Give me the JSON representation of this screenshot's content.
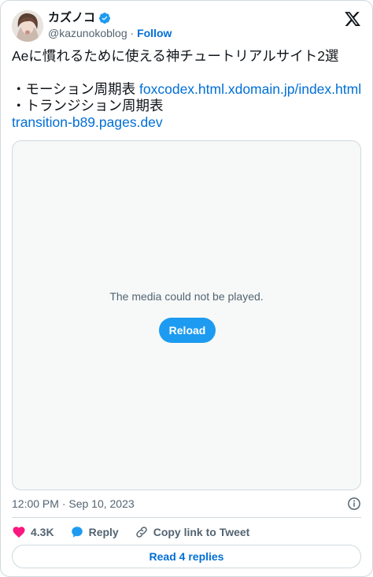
{
  "author": {
    "display_name": "カズノコ",
    "handle": "@kazunokoblog",
    "separator": "·",
    "follow_label": "Follow"
  },
  "tweet": {
    "line1": "Aeに慣れるために使える神チュートリアルサイト2選",
    "item1_label": "・モーション周期表 ",
    "item1_link": "foxcodex.html.xdomain.jp/index.html",
    "item2_label": "・トランジション周期表",
    "item2_link": "transition-b89.pages.dev"
  },
  "media": {
    "message": "The media could not be played.",
    "reload_label": "Reload"
  },
  "meta": {
    "timestamp": "12:00 PM · Sep 10, 2023"
  },
  "actions": {
    "likes_count": "4.3K",
    "reply_label": "Reply",
    "copy_link_label": "Copy link to Tweet"
  },
  "footer": {
    "read_replies_label": "Read 4 replies"
  },
  "colors": {
    "link": "#006fd6",
    "like_heart": "#f91880",
    "reply_bubble": "#1d9bf0",
    "reload_button": "#1d9bf0",
    "verified_badge": "#1d9bf0"
  }
}
